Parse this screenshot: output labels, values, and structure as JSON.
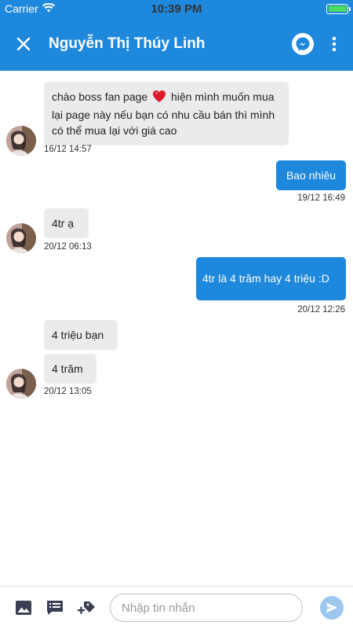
{
  "status_bar": {
    "carrier": "Carrier",
    "time": "10:39 PM",
    "battery_percent": 100
  },
  "header": {
    "title": "Nguyễn Thị Thúy Linh",
    "close_icon": "close-icon",
    "messenger_icon": "messenger-icon",
    "more_icon": "more-vertical-icon"
  },
  "colors": {
    "brand": "#1e88dc",
    "incoming_bubble": "#ebebeb",
    "send_button": "#9cc7ef",
    "battery": "#4cd964"
  },
  "messages": [
    {
      "direction": "incoming",
      "text_before_emoji": "chào boss fan page",
      "emoji": "❤️",
      "text_after_emoji": "hiện mình muốn mua lại page này nếu bạn có nhu cầu bán thì mình có thể mua lại với giá cao",
      "time": "16/12 14:57"
    },
    {
      "direction": "outgoing",
      "text": "Bao nhiêu",
      "time": "19/12 16:49"
    },
    {
      "direction": "incoming",
      "text": "4tr ạ",
      "time": "20/12 06:13"
    },
    {
      "direction": "outgoing",
      "text": "4tr là 4 trăm hay 4 triệu :D",
      "time": "20/12 12:26"
    },
    {
      "direction": "incoming",
      "text": "4 triệu bạn"
    },
    {
      "direction": "incoming",
      "text": "4 trăm",
      "time": "20/12 13:05"
    }
  ],
  "composer": {
    "placeholder": "Nhập tin nhắn",
    "value": "",
    "image_icon": "image-icon",
    "quick_reply_icon": "quick-reply-icon",
    "tag_icon": "add-tag-icon",
    "send_icon": "send-icon"
  }
}
